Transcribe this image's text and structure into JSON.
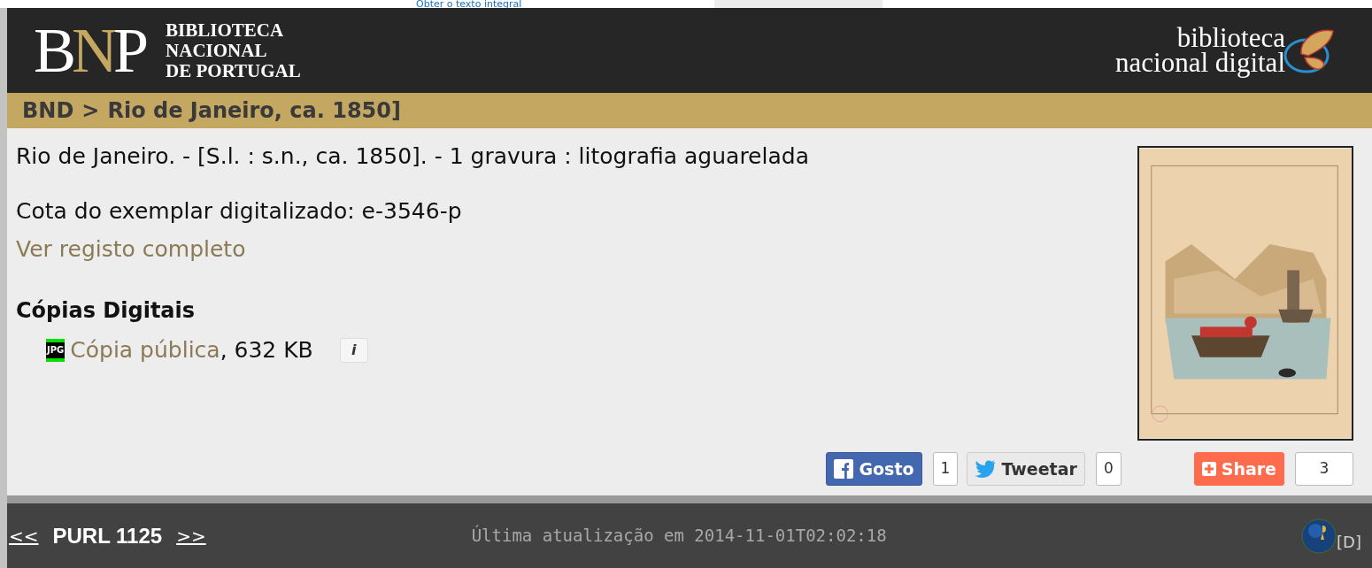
{
  "top_link": {
    "label": "Obter o texto integral"
  },
  "header": {
    "logo_mark": "BNP",
    "logo_text": [
      "BIBLIOTECA",
      "NACIONAL",
      "DE PORTUGAL"
    ],
    "digital_logo": [
      "biblioteca",
      "nacional digital"
    ]
  },
  "breadcrumb": [
    {
      "label": "BND"
    },
    {
      "label": ">"
    },
    {
      "label": "Rio de Janeiro, ca. 1850]"
    }
  ],
  "record": {
    "description": "Rio de Janeiro. - [S.l. : s.n., ca. 1850]. - 1 gravura : litografia aguarelada",
    "call_number": "Cota do exemplar digitalizado: e-3546-p",
    "full_record_link": "Ver registo completo"
  },
  "digital_copies": {
    "heading": "Cópias Digitais",
    "items": [
      {
        "format": "JPG",
        "link": "Cópia pública",
        "size": ", 632 KB",
        "info": "i"
      }
    ]
  },
  "social": [
    {
      "kind": "facebook",
      "label": "Gosto",
      "count": "1"
    },
    {
      "kind": "twitter",
      "label": "Tweetar",
      "count": "0"
    },
    {
      "kind": "share",
      "label": "Share",
      "count": "3"
    }
  ],
  "footer": {
    "prev": "<<",
    "purl": "PURL 1125",
    "next": ">>",
    "updated": "Última atualização em 2014-11-01T02:02:18",
    "badge": "[D]"
  }
}
